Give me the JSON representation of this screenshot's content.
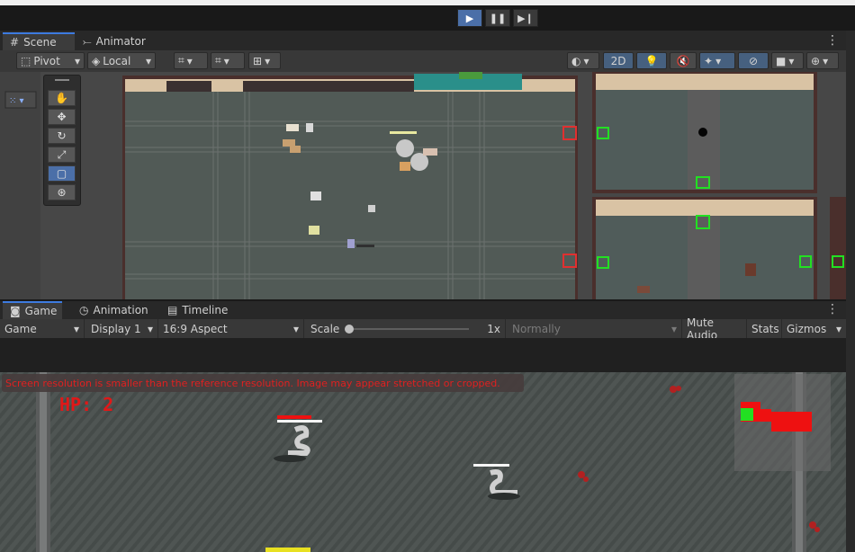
{
  "playbar": {
    "play_icon": "play-icon",
    "pause_icon": "pause-icon",
    "step_icon": "step-icon"
  },
  "scene_tabs": [
    {
      "label": "Scene",
      "icon": "grid-icon"
    },
    {
      "label": "Animator",
      "icon": "animator-icon"
    }
  ],
  "scene_toolbar": {
    "pivot_label": "Pivot",
    "local_label": "Local",
    "mode_2d_label": "2D"
  },
  "tools": [
    "hand-tool",
    "move-tool",
    "rotate-tool",
    "scale-tool",
    "rect-tool",
    "transform-tool"
  ],
  "game_tabs": [
    {
      "label": "Game",
      "icon": "gamepad-icon"
    },
    {
      "label": "Animation",
      "icon": "clock-icon"
    },
    {
      "label": "Timeline",
      "icon": "film-icon"
    }
  ],
  "game_toolbar": {
    "view_select": "Game",
    "display_select": "Display 1",
    "aspect_select": "16:9 Aspect",
    "scale_label": "Scale",
    "scale_value_text": "1x",
    "scale_value": 1,
    "play_focus_select": "Normally",
    "mute_audio": "Mute Audio",
    "stats": "Stats",
    "gizmos": "Gizmos"
  },
  "game": {
    "warning": "Screen resolution is smaller than the reference resolution. Image may appear stretched or cropped.",
    "hp_text": "HP: 2"
  },
  "colors": {
    "accent": "#3d7be0",
    "warning_text": "#e02020",
    "hp_text": "#e01818",
    "minimap_room_current": "#22e022",
    "minimap_room": "#ee1111"
  }
}
